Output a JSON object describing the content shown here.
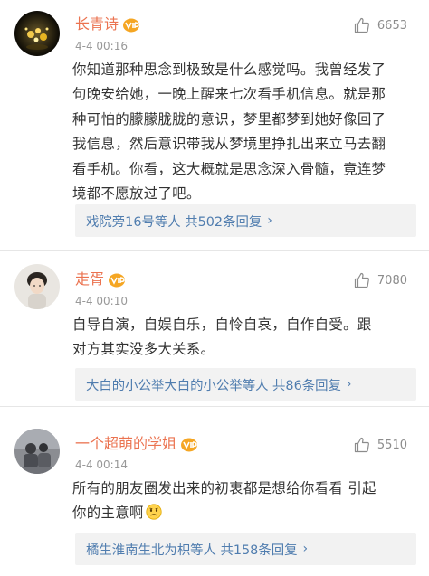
{
  "comments": [
    {
      "username": "长青诗",
      "timestamp": "4-4 00:16",
      "likes": "6653",
      "body_lines": [
        "你知道那种思念到极致是什么感觉吗。我曾经发了",
        "句晚安给她，一晚上醒来七次看手机信息。就是那",
        "种可怕的朦朦胧胧的意识，梦里都梦到她好像回了",
        "我信息，然后意识带我从梦境里挣扎出来立马去翻",
        "看手机。你看，这大概就是思念深入骨髓，竟连梦",
        "境都不愿放过了吧。"
      ],
      "reply_summary": "戏院旁16号等人  共502条回复",
      "reply_chevron": "›"
    },
    {
      "username": "走胥",
      "timestamp": "4-4 00:10",
      "likes": "7080",
      "body_lines": [
        "自导自演，自娱自乐，自怜自哀，自作自受。跟",
        "对方其实没多大关系。"
      ],
      "reply_summary": "大白的小公举大白的小公举等人  共86条回复",
      "reply_chevron": "›"
    },
    {
      "username": "一个超萌的学姐",
      "timestamp": "4-4 00:14",
      "likes": "5510",
      "body_lines": [
        "所有的朋友圈发出来的初衷都是想给你看看 引起",
        "你的主意啊"
      ],
      "reply_summary": "橘生淮南生北为枳等人  共158条回复",
      "reply_chevron": "›"
    }
  ],
  "colors": {
    "username": "#eb7350",
    "reply_link": "#507daf",
    "body_text": "#333333",
    "meta_text": "#999999",
    "reply_bg": "#f2f2f2"
  },
  "icons": {
    "like": "thumbs-up-outline-icon",
    "vip": "vip-badge-icon",
    "emoji": "sad-face-emoji-icon"
  }
}
